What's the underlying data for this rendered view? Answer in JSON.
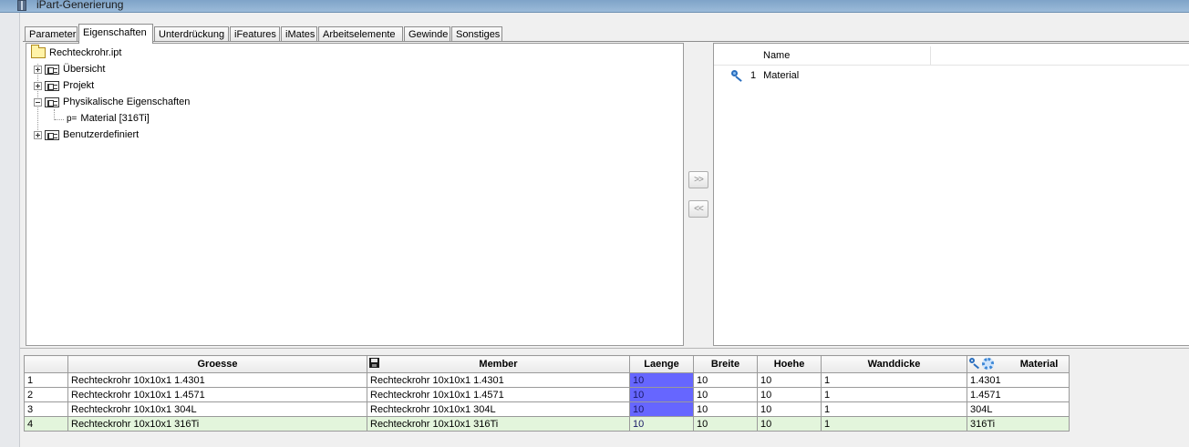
{
  "window": {
    "title": "iPart-Generierung"
  },
  "tabs": [
    {
      "label": "Parameter"
    },
    {
      "label": "Eigenschaften",
      "active": true
    },
    {
      "label": "Unterdrückung"
    },
    {
      "label": "iFeatures"
    },
    {
      "label": "iMates"
    },
    {
      "label": "Arbeitselemente"
    },
    {
      "label": "Gewinde"
    },
    {
      "label": "Sonstiges"
    }
  ],
  "tree": {
    "root": "Rechteckrohr.ipt",
    "nodes": [
      {
        "label": "Übersicht",
        "expanded": false
      },
      {
        "label": "Projekt",
        "expanded": false
      },
      {
        "label": "Physikalische Eigenschaften",
        "expanded": true
      },
      {
        "label": "Material [316Ti]",
        "prefix": "p="
      },
      {
        "label": "Benutzerdefiniert",
        "expanded": false
      }
    ]
  },
  "transfer_buttons": {
    "add": ">>",
    "remove": "<<"
  },
  "selected_list": {
    "column_header": "Name",
    "rows": [
      {
        "num": "1",
        "name": "Material",
        "icon": "key-icon"
      }
    ]
  },
  "table": {
    "headers": [
      "",
      "Groesse",
      "Member",
      "Laenge",
      "Breite",
      "Hoehe",
      "Wanddicke",
      "Material"
    ],
    "rows": [
      [
        "1",
        "Rechteckrohr 10x10x1  1.4301",
        "Rechteckrohr 10x10x1  1.4301",
        "10",
        "10",
        "10",
        "1",
        "1.4301"
      ],
      [
        "2",
        "Rechteckrohr 10x10x1  1.4571",
        "Rechteckrohr 10x10x1  1.4571",
        "10",
        "10",
        "10",
        "1",
        "1.4571"
      ],
      [
        "3",
        "Rechteckrohr 10x10x1  304L",
        "Rechteckrohr 10x10x1  304L",
        "10",
        "10",
        "10",
        "1",
        "304L"
      ],
      [
        "4",
        "Rechteckrohr 10x10x1  316Ti",
        "Rechteckrohr 10x10x1  316Ti",
        "10",
        "10",
        "10",
        "1",
        "316Ti"
      ]
    ],
    "selected_row": 4,
    "colors": {
      "key_column": "#6666ff",
      "selected_row": "#e3f5dc"
    }
  }
}
